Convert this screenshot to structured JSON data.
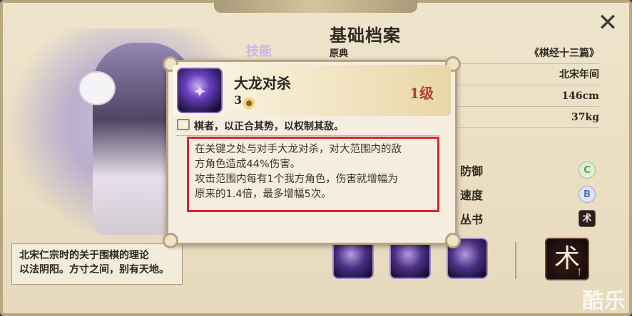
{
  "window": {
    "title": "基础档案"
  },
  "profile": {
    "behind_label": "技能",
    "sub_label": "原典",
    "info_rows": [
      "《棋经十三篇》",
      "北宋年间",
      "146cm",
      "37kg"
    ],
    "description_lines": [
      "北宋仁宗时的关于围棋的理论",
      "以法阴阳。方寸之间，别有天地。"
    ]
  },
  "stats": [
    {
      "label": "防御",
      "grade": "C"
    },
    {
      "label": "速度",
      "grade": "B"
    },
    {
      "label": "丛书",
      "grade": "术"
    }
  ],
  "skills_bar": {
    "big_icon": "术",
    "upgrade_arrow": "↑"
  },
  "popup": {
    "skill_name": "大龙对杀",
    "cost": "3",
    "level": "1级",
    "quote": "棋者，以正合其势，以权制其敌。",
    "desc_lines": [
      "在关键之处与对手大龙对杀，对大范围内的敌",
      "方角色造成44%伤害。",
      "攻击范围内每有1个我方角色，伤害就增幅为",
      "原来的1.4倍，最多增幅5次。"
    ]
  },
  "close_label": "✕",
  "watermark": "酷乐",
  "colors": {
    "highlight_box": "#e0232a",
    "level": "#b0422c",
    "skill_icon": "#6a3fbf"
  },
  "icons": {
    "close": "close-icon",
    "book": "book-icon",
    "coin": "coin-icon"
  }
}
